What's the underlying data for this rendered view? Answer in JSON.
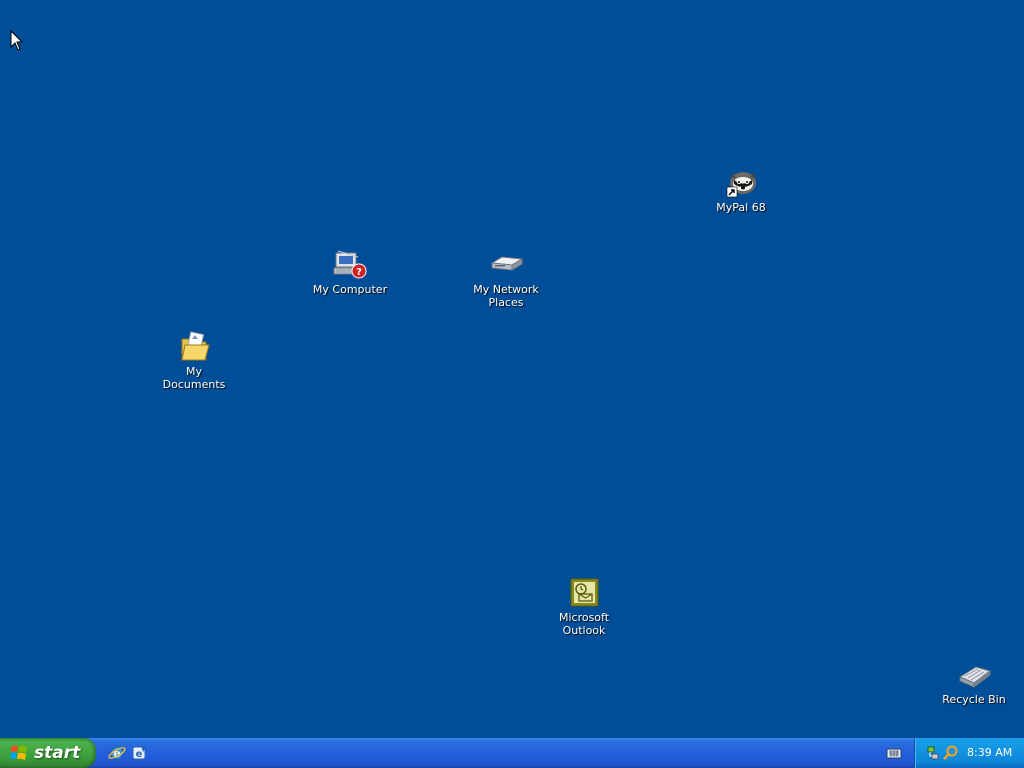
{
  "desktop": {
    "background_color": "#004e98",
    "icons": [
      {
        "label": "My Computer",
        "icon": "my-computer-icon"
      },
      {
        "label": "My Network Places",
        "icon": "network-places-icon"
      },
      {
        "label": "MyPal 68",
        "icon": "mypal-icon"
      },
      {
        "label": "My Documents",
        "icon": "my-documents-icon"
      },
      {
        "label": "Microsoft Outlook",
        "icon": "outlook-icon"
      },
      {
        "label": "Recycle Bin",
        "icon": "recycle-bin-icon"
      }
    ]
  },
  "taskbar": {
    "start_label": "start",
    "quick_launch": [
      "internet-explorer-icon",
      "outlook-express-icon"
    ],
    "language_icon": "keyboard-icon",
    "tray": {
      "icons": [
        "network-icon",
        "search-icon"
      ],
      "clock": "8:39 AM"
    }
  }
}
